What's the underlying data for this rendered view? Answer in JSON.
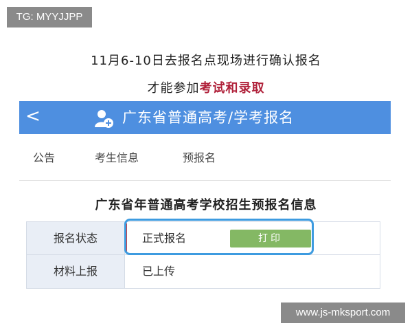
{
  "watermark_top_left": "TG: MYYJJPP",
  "watermark_bottom_right": "www.js-mksport.com",
  "caption": {
    "line1": "11月6-10日去报名点现场进行确认报名",
    "line2_prefix": "才能参加",
    "line2_highlight": "考试和录取"
  },
  "header": {
    "back_glyph": "<",
    "title": "广东省普通高考/学考报名",
    "icon": "user-add-icon",
    "background": "#4e8fe0"
  },
  "tabs": [
    "公告",
    "考生信息",
    "预报名"
  ],
  "section_title": "广东省年普通高考学校招生预报名信息",
  "table": {
    "rows": [
      {
        "label": "报名状态",
        "value": "正式报名",
        "button": "打印"
      },
      {
        "label": "材料上报",
        "value": "已上传"
      }
    ]
  },
  "colors": {
    "accent": "#4e8fe0",
    "highlight_red": "#b0213a",
    "print_button": "#84b864",
    "annotation_box": "#3d9be0"
  }
}
